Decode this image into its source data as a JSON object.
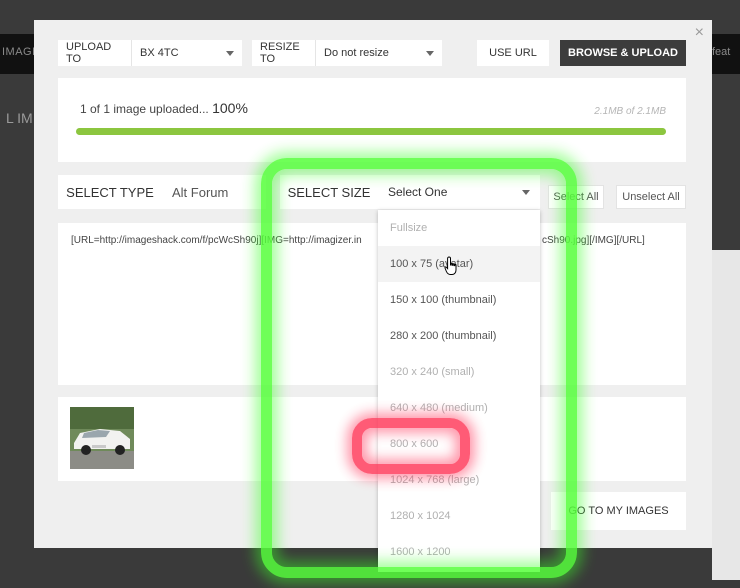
{
  "background": {
    "left_label": "IMAGE",
    "right_label": "feat",
    "left_partial": "L IM"
  },
  "modal": {
    "close_label": "×",
    "upload_to_label": "UPLOAD TO",
    "upload_to_value": "BX 4TC",
    "resize_to_label": "RESIZE TO",
    "resize_to_value": "Do not resize",
    "use_url_label": "USE URL",
    "browse_upload_label": "BROWSE & UPLOAD",
    "progress": {
      "status_text": "1 of 1 image uploaded...",
      "percent_text": "100%",
      "size_text": "2.1MB of 2.1MB",
      "fraction": 1.0
    },
    "select_type_label": "SELECT TYPE",
    "select_type_value": "Alt Forum",
    "select_size_label": "SELECT SIZE",
    "select_size_value": "Select One",
    "select_all_label": "Select All",
    "unselect_all_label": "Unselect All",
    "code_text_left": "[URL=http://imageshack.com/f/pcWcSh90j][IMG=http://imagizer.in",
    "code_text_right": "cSh90.jpg][/IMG][/URL]",
    "go_to_images_label": "GO TO MY IMAGES"
  },
  "size_dropdown": {
    "items": [
      {
        "label": "Fullsize",
        "disabled": true
      },
      {
        "label": "100 x 75 (avatar)",
        "disabled": false
      },
      {
        "label": "150 x 100 (thumbnail)",
        "disabled": false
      },
      {
        "label": "280 x 200 (thumbnail)",
        "disabled": false
      },
      {
        "label": "320 x 240 (small)",
        "disabled": true
      },
      {
        "label": "640 x 480 (medium)",
        "disabled": true
      },
      {
        "label": "800 x 600",
        "disabled": true
      },
      {
        "label": "1024 x 768 (large)",
        "disabled": true
      },
      {
        "label": "1280 x 1024",
        "disabled": true
      },
      {
        "label": "1600 x 1200",
        "disabled": true
      }
    ]
  },
  "colors": {
    "progress": "#8cc63f",
    "primary_button": "#3c3c3c",
    "highlight_green": "#56ff3c",
    "highlight_red": "#ff3355"
  }
}
